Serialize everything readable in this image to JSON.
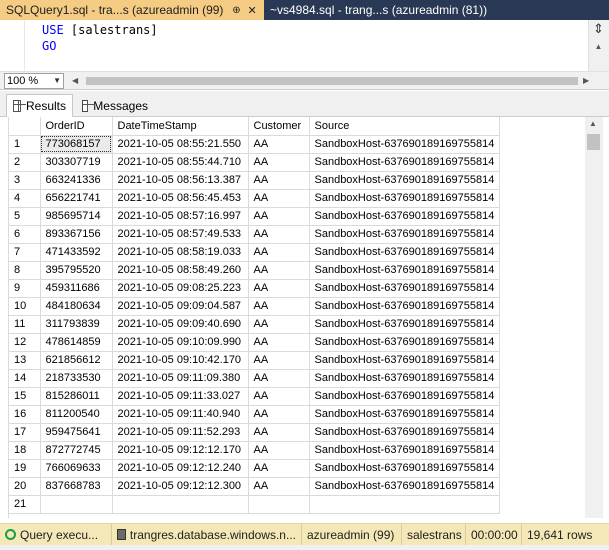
{
  "tabs": [
    {
      "title": "SQLQuery1.sql - tra...s (azureadmin (99))",
      "pin": "⊕",
      "close": "✕"
    },
    {
      "title": "~vs4984.sql - trang...s (azureadmin (81))"
    }
  ],
  "editor": {
    "line1_kw": "USE",
    "line1_ident": "[salestrans]",
    "line2_kw": "GO",
    "line3": "           "
  },
  "zoom": {
    "value": "100 %"
  },
  "result_tabs": {
    "results": "Results",
    "messages": "Messages"
  },
  "grid": {
    "columns": [
      "",
      "OrderID",
      "DateTimeStamp",
      "Customer",
      "Source"
    ],
    "rows": [
      [
        "1",
        "773068157",
        "2021-10-05 08:55:21.550",
        "AA",
        "SandboxHost-637690189169755814"
      ],
      [
        "2",
        "303307719",
        "2021-10-05 08:55:44.710",
        "AA",
        "SandboxHost-637690189169755814"
      ],
      [
        "3",
        "663241336",
        "2021-10-05 08:56:13.387",
        "AA",
        "SandboxHost-637690189169755814"
      ],
      [
        "4",
        "656221741",
        "2021-10-05 08:56:45.453",
        "AA",
        "SandboxHost-637690189169755814"
      ],
      [
        "5",
        "985695714",
        "2021-10-05 08:57:16.997",
        "AA",
        "SandboxHost-637690189169755814"
      ],
      [
        "6",
        "893367156",
        "2021-10-05 08:57:49.533",
        "AA",
        "SandboxHost-637690189169755814"
      ],
      [
        "7",
        "471433592",
        "2021-10-05 08:58:19.033",
        "AA",
        "SandboxHost-637690189169755814"
      ],
      [
        "8",
        "395795520",
        "2021-10-05 08:58:49.260",
        "AA",
        "SandboxHost-637690189169755814"
      ],
      [
        "9",
        "459311686",
        "2021-10-05 09:08:25.223",
        "AA",
        "SandboxHost-637690189169755814"
      ],
      [
        "10",
        "484180634",
        "2021-10-05 09:09:04.587",
        "AA",
        "SandboxHost-637690189169755814"
      ],
      [
        "11",
        "311793839",
        "2021-10-05 09:09:40.690",
        "AA",
        "SandboxHost-637690189169755814"
      ],
      [
        "12",
        "478614859",
        "2021-10-05 09:10:09.990",
        "AA",
        "SandboxHost-637690189169755814"
      ],
      [
        "13",
        "621856612",
        "2021-10-05 09:10:42.170",
        "AA",
        "SandboxHost-637690189169755814"
      ],
      [
        "14",
        "218733530",
        "2021-10-05 09:11:09.380",
        "AA",
        "SandboxHost-637690189169755814"
      ],
      [
        "15",
        "815286011",
        "2021-10-05 09:11:33.027",
        "AA",
        "SandboxHost-637690189169755814"
      ],
      [
        "16",
        "811200540",
        "2021-10-05 09:11:40.940",
        "AA",
        "SandboxHost-637690189169755814"
      ],
      [
        "17",
        "959475641",
        "2021-10-05 09:11:52.293",
        "AA",
        "SandboxHost-637690189169755814"
      ],
      [
        "18",
        "872772745",
        "2021-10-05 09:12:12.170",
        "AA",
        "SandboxHost-637690189169755814"
      ],
      [
        "19",
        "766069633",
        "2021-10-05 09:12:12.240",
        "AA",
        "SandboxHost-637690189169755814"
      ],
      [
        "20",
        "837668783",
        "2021-10-05 09:12:12.300",
        "AA",
        "SandboxHost-637690189169755814"
      ],
      [
        "21",
        "",
        "",
        "",
        ""
      ]
    ]
  },
  "status": {
    "query": "Query execu...",
    "server": "trangres.database.windows.n...",
    "user": "azureadmin (99)",
    "database": "salestrans",
    "time": "00:00:00",
    "rows": "19,641 rows"
  },
  "colors": {
    "tabbar_bg": "#293955",
    "active_tab_bg": "#f5cc84",
    "statusbar_bg": "#f5e8b8",
    "keyword": "#0000ff"
  }
}
